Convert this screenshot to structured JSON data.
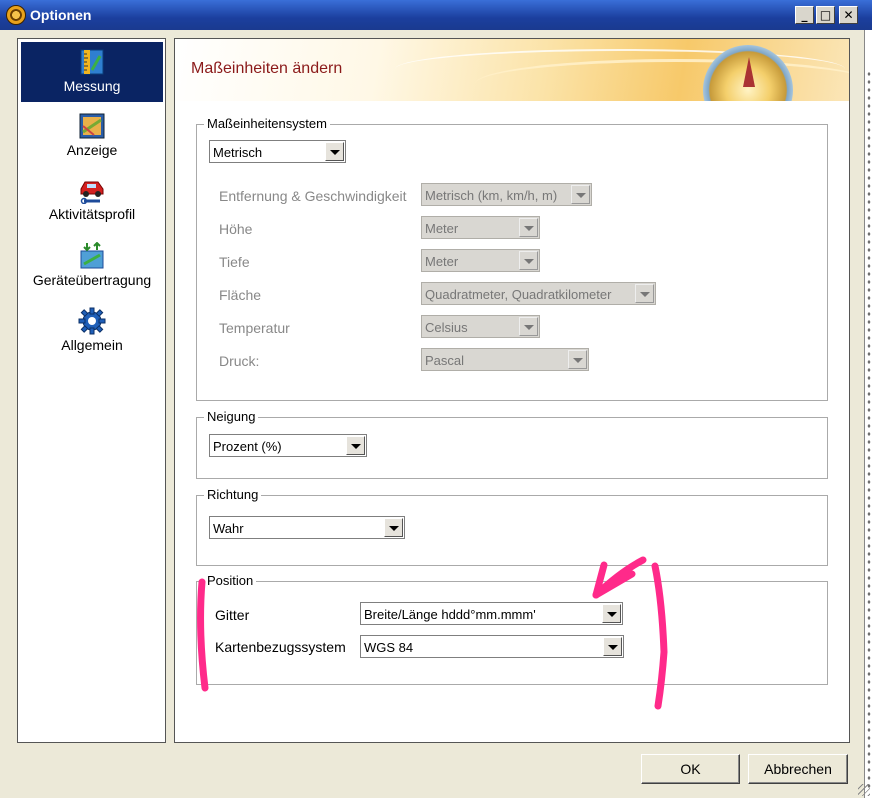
{
  "window": {
    "title": "Optionen"
  },
  "titlebar_buttons": {
    "minimize": "_",
    "maximize": "□",
    "close": "✕"
  },
  "sidebar": {
    "items": [
      {
        "label": "Messung",
        "icon": "ruler-map-icon",
        "active": true
      },
      {
        "label": "Anzeige",
        "icon": "display-icon",
        "active": false
      },
      {
        "label": "Aktivitätsprofil",
        "icon": "car-wrench-icon",
        "active": false
      },
      {
        "label": "Geräteübertragung",
        "icon": "device-transfer-icon",
        "active": false
      },
      {
        "label": "Allgemein",
        "icon": "gear-icon",
        "active": false
      }
    ]
  },
  "header": {
    "title": "Maßeinheiten ändern"
  },
  "units_system": {
    "legend": "Maßeinheitensystem",
    "selected": "Metrisch",
    "rows": [
      {
        "label": "Entfernung & Geschwindigkeit",
        "value": "Metrisch (km, km/h, m)"
      },
      {
        "label": "Höhe",
        "value": "Meter"
      },
      {
        "label": "Tiefe",
        "value": "Meter"
      },
      {
        "label": "Fläche",
        "value": "Quadratmeter, Quadratkilometer"
      },
      {
        "label": "Temperatur",
        "value": "Celsius"
      },
      {
        "label": "Druck:",
        "value": "Pascal"
      }
    ]
  },
  "slope": {
    "legend": "Neigung",
    "selected": "Prozent (%)"
  },
  "heading": {
    "legend": "Richtung",
    "selected": "Wahr"
  },
  "position": {
    "legend": "Position",
    "grid_label": "Gitter",
    "grid_value": "Breite/Länge hddd°mm.mmm'",
    "datum_label": "Kartenbezugssystem",
    "datum_value": "WGS 84"
  },
  "buttons": {
    "ok": "OK",
    "cancel": "Abbrechen"
  },
  "colors": {
    "active_nav": "#0a2463",
    "header_text": "#8b1a1a",
    "annotation": "#ff2a8a"
  }
}
